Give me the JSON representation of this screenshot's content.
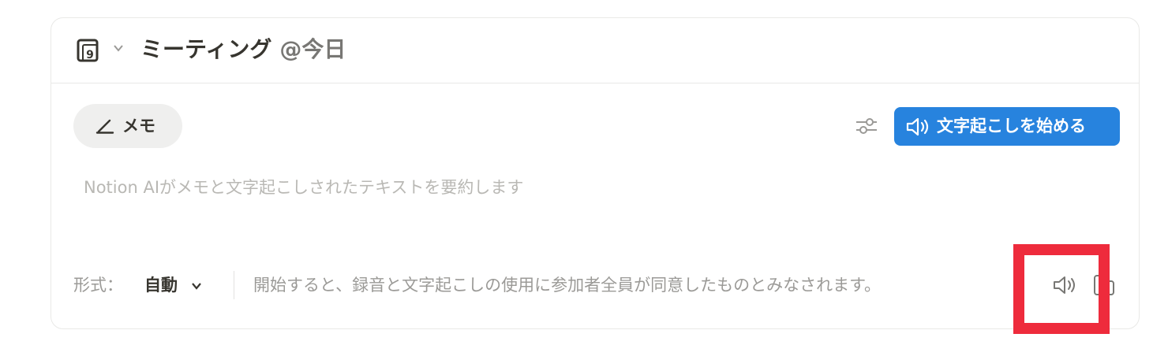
{
  "header": {
    "icon": "calendar-icon",
    "calendar_day": "9",
    "title": "ミーティング",
    "date_mention": "@今日"
  },
  "toolbar": {
    "memo_tab_label": "メモ",
    "transcribe_button_label": "文字起こしを始める",
    "settings_icon": "settings-sliders-icon"
  },
  "content": {
    "placeholder": "Notion AIがメモと文字起こしされたテキストを要約します"
  },
  "footer": {
    "format_label": "形式：",
    "format_value": "自動",
    "consent_text": "開始すると、録音と文字起こしの使用に参加者全員が同意したものとみなされます。",
    "audio_icon": "speaker-icon",
    "device_icon": "device-icon"
  },
  "colors": {
    "accent": "#2783de",
    "highlight": "#ee2b3c",
    "text_primary": "#37352f",
    "text_muted": "#9b9a97"
  }
}
